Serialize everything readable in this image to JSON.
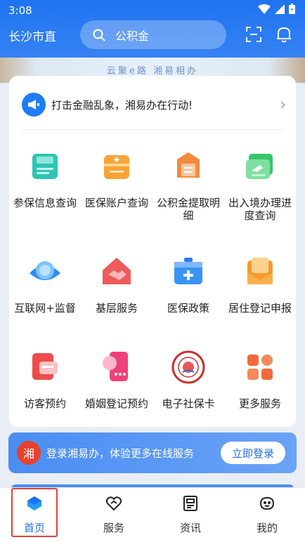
{
  "status": {
    "time": "3:08"
  },
  "header": {
    "city": "长沙市直",
    "search_placeholder": "公积金"
  },
  "banner": {
    "slogan": "云聚e路 湘易相办"
  },
  "notice": {
    "text": "打击金融乱象，湘易办在行动!"
  },
  "services": [
    {
      "label": "参保信息查询",
      "icon": "insurance-card-icon"
    },
    {
      "label": "医保账户查询",
      "icon": "medical-wallet-icon"
    },
    {
      "label": "公积金提取明细",
      "icon": "fund-detail-icon"
    },
    {
      "label": "出入境办理进度查询",
      "icon": "passport-icon"
    },
    {
      "label": "互联网+监督",
      "icon": "eye-supervision-icon"
    },
    {
      "label": "基层服务",
      "icon": "handshake-home-icon"
    },
    {
      "label": "医保政策",
      "icon": "medical-kit-icon"
    },
    {
      "label": "居住登记申报",
      "icon": "residence-envelope-icon"
    },
    {
      "label": "访客预约",
      "icon": "visitor-card-icon"
    },
    {
      "label": "婚姻登记预约",
      "icon": "marriage-phone-icon"
    },
    {
      "label": "电子社保卡",
      "icon": "social-security-badge-icon"
    },
    {
      "label": "更多服务",
      "icon": "more-grid-icon"
    }
  ],
  "login_bar": {
    "text": "登录湘易办，体验更多在线服务",
    "button": "立即登录",
    "logo_text": "湘"
  },
  "tabs": [
    {
      "label": "首页",
      "icon": "home-icon",
      "active": true
    },
    {
      "label": "服务",
      "icon": "service-icon",
      "active": false
    },
    {
      "label": "资讯",
      "icon": "news-icon",
      "active": false
    },
    {
      "label": "我的",
      "icon": "profile-icon",
      "active": false
    }
  ],
  "colors": {
    "primary": "#1f73f0",
    "highlight": "#e0413a"
  }
}
